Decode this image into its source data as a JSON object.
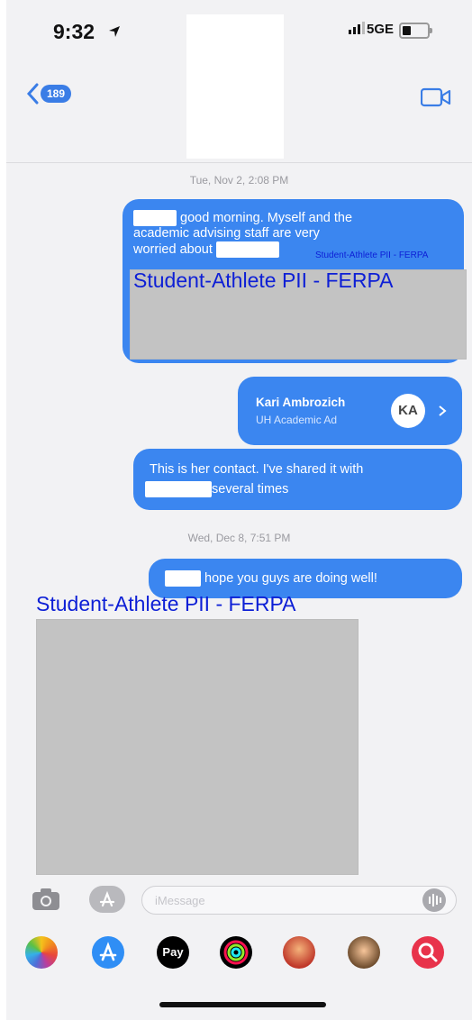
{
  "status_bar": {
    "time": "9:32",
    "network": "5GE"
  },
  "header": {
    "back_count": "189"
  },
  "timestamps": {
    "first": "Tue, Nov 2, 2:08 PM",
    "second": "Wed, Dec 8, 7:51 PM"
  },
  "messages": {
    "m1_line1": "good morning. Myself and the",
    "m1_line2": "academic advising staff are very",
    "m1_line3": "worried about",
    "m1_small_redaction": "Student-Athlete PII - FERPA",
    "m1_large_redaction": "Student-Athlete PII - FERPA",
    "contact_name": "Kari Ambrozich",
    "contact_subtitle": "UH Academic Ad",
    "contact_initials": "KA",
    "m3_line1": "This is her contact. I've shared it with",
    "m3_line2": "several times",
    "m4_text": "hope you guys are doing well!"
  },
  "redaction_image": {
    "label": "Student-Athlete PII - FERPA"
  },
  "input_bar": {
    "placeholder": "iMessage"
  },
  "app_tray": {
    "apps": [
      "photos-app",
      "app-store-app",
      "apple-pay-app",
      "activity-app",
      "memoji-app",
      "memoji-stickers-app",
      "search-images-app"
    ],
    "apple_pay_label": "Pay"
  }
}
